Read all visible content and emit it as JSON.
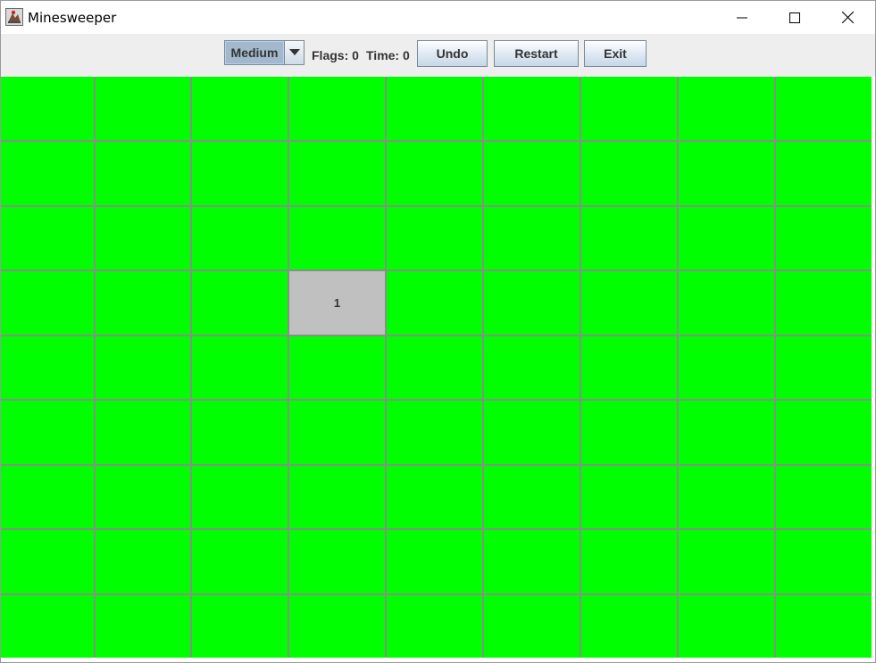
{
  "window": {
    "title": "Minesweeper",
    "icon": "minesweeper-app-icon"
  },
  "toolbar": {
    "difficulty_value": "Medium",
    "flags_label": "Flags: 0",
    "time_label": "Time: 0",
    "undo_label": "Undo",
    "restart_label": "Restart",
    "exit_label": "Exit"
  },
  "board": {
    "rows": 9,
    "cols": 9,
    "unrevealed_color": "#00ff00",
    "revealed_color": "#c0c0c0",
    "revealed_cells": [
      {
        "row": 3,
        "col": 3,
        "value": "1"
      }
    ]
  }
}
